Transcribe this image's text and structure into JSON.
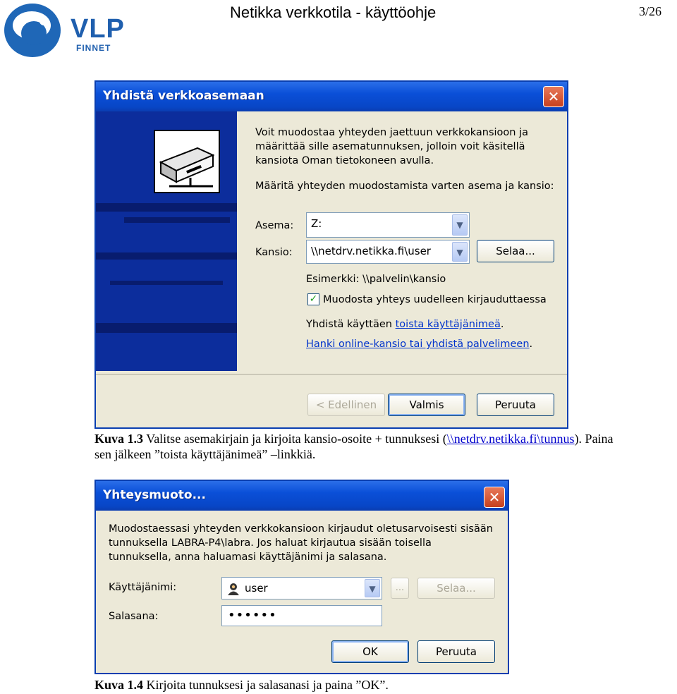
{
  "header": {
    "logo_text": "VLP",
    "logo_subtext": "FINNET",
    "doc_title": "Netikka verkkotila - käyttöohje",
    "page_number": "3/26"
  },
  "dialog1": {
    "title": "Yhdistä verkkoasemaan",
    "close": "✕",
    "intro": "Voit muodostaa yhteyden jaettuun verkkokansioon ja määrittää sille asematunnuksen, jolloin voit käsitellä kansiota Oman tietokoneen avulla.",
    "intro_lines": [
      "Voit muodostaa yhteyden jaettuun verkkokansioon ja",
      "määrittää sille asematunnuksen, jolloin voit käsitellä",
      "kansiota Oman tietokoneen avulla."
    ],
    "instruction": "Määritä yhteyden muodostamista varten asema ja kansio:",
    "drive_label": "Asema:",
    "drive_value": "Z:",
    "folder_label": "Kansio:",
    "folder_value": "\\\\netdrv.netikka.fi\\user",
    "browse_button": "Selaa...",
    "example": "Esimerkki: \\\\palvelin\\kansio",
    "reconnect_checkbox": "Muodosta yhteys uudelleen kirjauduttaessa",
    "reconnect_checked": true,
    "connect_as_prefix": "Yhdistä käyttäen",
    "connect_as_link": "toista käyttäjänimeä",
    "connect_as_suffix": ".",
    "online_link": "Hanki online-kansio tai yhdistä palvelimeen",
    "online_suffix": ".",
    "back_button": "< Edellinen",
    "finish_button": "Valmis",
    "cancel_button": "Peruuta"
  },
  "caption1": {
    "label": "Kuva 1.3",
    "text_before": " Valitse asemakirjain ja kirjoita kansio-osoite + tunnuksesi (",
    "link": "\\\\netdrv.netikka.fi\\tunnus",
    "text_after": "). Paina",
    "line2": "sen jälkeen ”toista käyttäjänimeä” –linkkiä."
  },
  "dialog2": {
    "title": "Yhteysmuoto...",
    "close": "✕",
    "intro_lines": [
      "Muodostaessasi yhteyden verkkokansioon kirjaudut oletusarvoisesti sisään",
      "tunnuksella LABRA-P4\\labra. Jos haluat kirjautua sisään toisella",
      "tunnuksella, anna haluamasi käyttäjänimi ja salasana."
    ],
    "username_label": "Käyttäjänimi:",
    "username_value": "user",
    "ellipsis_button": "...",
    "browse_button": "Selaa...",
    "password_label": "Salasana:",
    "password_value": "••••••",
    "ok_button": "OK",
    "cancel_button": "Peruuta"
  },
  "caption2": {
    "label": "Kuva 1.4",
    "text": " Kirjoita tunnuksesi ja salasanasi ja paina ”OK”."
  },
  "colors": {
    "titlebar": "#0a4fd8",
    "dialog_bg": "#ece9d8",
    "side_panel": "#0c2d9c",
    "link": "#0033cc",
    "logo_blue": "#1f67b7"
  }
}
